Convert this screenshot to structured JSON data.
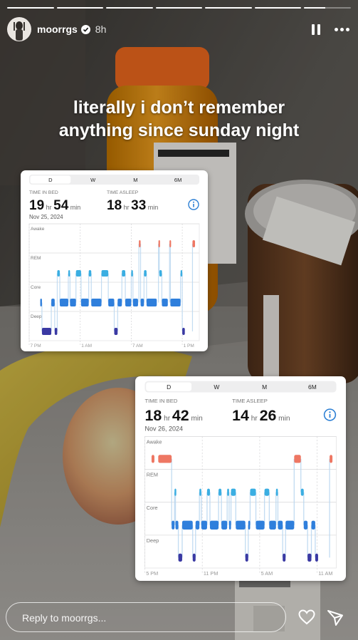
{
  "story": {
    "progress_segments": 7,
    "active_segment": 6,
    "username": "moorrgs",
    "time_ago": "8h",
    "caption_line1": "literally i don’t remember",
    "caption_line2": "anything since sunday night"
  },
  "sleep_cards": [
    {
      "tabs": [
        "D",
        "W",
        "M",
        "6M"
      ],
      "selected_tab": "D",
      "time_in_bed_label": "TIME IN BED",
      "time_in_bed_hr": "19",
      "time_in_bed_min": "54",
      "time_asleep_label": "TIME ASLEEP",
      "time_asleep_hr": "18",
      "time_asleep_min": "33",
      "hr_unit": "hr",
      "min_unit": "min",
      "date": "Nov 25, 2024",
      "stages": [
        "Awake",
        "REM",
        "Core",
        "Deep"
      ],
      "time_labels": [
        "7 PM",
        "1 AM",
        "7 AM",
        "1 PM"
      ],
      "chart_data": {
        "type": "timeline",
        "rows": [
          "Awake",
          "REM",
          "Core",
          "Deep"
        ],
        "start_time": "7 PM",
        "time_ticks": [
          "7 PM",
          "1 AM",
          "7 AM",
          "1 PM"
        ],
        "hours_span": 20,
        "segments": [
          {
            "stage": "Core",
            "start": 1.3,
            "end": 1.5
          },
          {
            "stage": "Deep",
            "start": 1.5,
            "end": 2.6
          },
          {
            "stage": "Core",
            "start": 2.6,
            "end": 3.0
          },
          {
            "stage": "Deep",
            "start": 3.0,
            "end": 3.3
          },
          {
            "stage": "REM",
            "start": 3.3,
            "end": 3.6
          },
          {
            "stage": "Core",
            "start": 3.6,
            "end": 4.6
          },
          {
            "stage": "REM",
            "start": 4.6,
            "end": 4.8
          },
          {
            "stage": "Core",
            "start": 4.8,
            "end": 5.5
          },
          {
            "stage": "REM",
            "start": 5.5,
            "end": 6.1
          },
          {
            "stage": "Core",
            "start": 6.1,
            "end": 7.0
          },
          {
            "stage": "REM",
            "start": 7.0,
            "end": 7.3
          },
          {
            "stage": "Core",
            "start": 7.3,
            "end": 8.5
          },
          {
            "stage": "REM",
            "start": 8.5,
            "end": 9.3
          },
          {
            "stage": "Core",
            "start": 9.3,
            "end": 10.0
          },
          {
            "stage": "Deep",
            "start": 10.0,
            "end": 10.4
          },
          {
            "stage": "Core",
            "start": 10.4,
            "end": 10.9
          },
          {
            "stage": "REM",
            "start": 10.9,
            "end": 11.3
          },
          {
            "stage": "Core",
            "start": 11.3,
            "end": 12.0
          },
          {
            "stage": "REM",
            "start": 12.0,
            "end": 12.2
          },
          {
            "stage": "Core",
            "start": 12.2,
            "end": 12.8
          },
          {
            "stage": "Awake",
            "start": 12.9,
            "end": 13.1
          },
          {
            "stage": "Core",
            "start": 13.1,
            "end": 13.5
          },
          {
            "stage": "REM",
            "start": 13.5,
            "end": 13.8
          },
          {
            "stage": "Core",
            "start": 13.8,
            "end": 15.0
          },
          {
            "stage": "Awake",
            "start": 15.2,
            "end": 15.3
          },
          {
            "stage": "REM",
            "start": 15.3,
            "end": 15.6
          },
          {
            "stage": "Core",
            "start": 15.6,
            "end": 16.3
          },
          {
            "stage": "Awake",
            "start": 16.5,
            "end": 16.6
          },
          {
            "stage": "Core",
            "start": 16.6,
            "end": 17.8
          },
          {
            "stage": "REM",
            "start": 17.8,
            "end": 18.0
          },
          {
            "stage": "Deep",
            "start": 18.0,
            "end": 18.3
          },
          {
            "stage": "Awake",
            "start": 19.2,
            "end": 19.5
          }
        ]
      }
    },
    {
      "tabs": [
        "D",
        "W",
        "M",
        "6M"
      ],
      "selected_tab": "D",
      "time_in_bed_label": "TIME IN BED",
      "time_in_bed_hr": "18",
      "time_in_bed_min": "42",
      "time_asleep_label": "TIME ASLEEP",
      "time_asleep_hr": "14",
      "time_asleep_min": "26",
      "hr_unit": "hr",
      "min_unit": "min",
      "date": "Nov 26, 2024",
      "stages": [
        "Awake",
        "REM",
        "Core",
        "Deep"
      ],
      "time_labels": [
        "5 PM",
        "11 PM",
        "5 AM",
        "11 AM"
      ],
      "chart_data": {
        "type": "timeline",
        "rows": [
          "Awake",
          "REM",
          "Core",
          "Deep"
        ],
        "start_time": "5 PM",
        "time_ticks": [
          "5 PM",
          "11 PM",
          "5 AM",
          "11 AM"
        ],
        "hours_span": 20,
        "segments": [
          {
            "stage": "Awake",
            "start": 0.7,
            "end": 1.0
          },
          {
            "stage": "Awake",
            "start": 1.4,
            "end": 2.8
          },
          {
            "stage": "Core",
            "start": 2.8,
            "end": 3.1
          },
          {
            "stage": "REM",
            "start": 3.1,
            "end": 3.2
          },
          {
            "stage": "Core",
            "start": 3.2,
            "end": 3.5
          },
          {
            "stage": "Deep",
            "start": 3.5,
            "end": 3.9
          },
          {
            "stage": "Core",
            "start": 3.9,
            "end": 5.0
          },
          {
            "stage": "Deep",
            "start": 5.0,
            "end": 5.3
          },
          {
            "stage": "Core",
            "start": 5.3,
            "end": 5.7
          },
          {
            "stage": "REM",
            "start": 5.7,
            "end": 5.9
          },
          {
            "stage": "Core",
            "start": 5.9,
            "end": 6.5
          },
          {
            "stage": "REM",
            "start": 6.5,
            "end": 6.8
          },
          {
            "stage": "Core",
            "start": 6.8,
            "end": 7.7
          },
          {
            "stage": "REM",
            "start": 7.7,
            "end": 8.0
          },
          {
            "stage": "Core",
            "start": 8.0,
            "end": 8.6
          },
          {
            "stage": "REM",
            "start": 8.6,
            "end": 8.8
          },
          {
            "stage": "Core",
            "start": 8.8,
            "end": 9.0
          },
          {
            "stage": "REM",
            "start": 9.0,
            "end": 9.5
          },
          {
            "stage": "Core",
            "start": 9.5,
            "end": 10.5
          },
          {
            "stage": "Deep",
            "start": 10.5,
            "end": 10.8
          },
          {
            "stage": "Core",
            "start": 10.8,
            "end": 11.0
          },
          {
            "stage": "REM",
            "start": 11.0,
            "end": 11.6
          },
          {
            "stage": "Core",
            "start": 11.6,
            "end": 12.5
          },
          {
            "stage": "REM",
            "start": 12.5,
            "end": 13.0
          },
          {
            "stage": "Core",
            "start": 13.0,
            "end": 13.7
          },
          {
            "stage": "REM",
            "start": 13.7,
            "end": 13.9
          },
          {
            "stage": "Core",
            "start": 13.9,
            "end": 14.4
          },
          {
            "stage": "Deep",
            "start": 14.4,
            "end": 14.7
          },
          {
            "stage": "Core",
            "start": 14.7,
            "end": 15.6
          },
          {
            "stage": "Awake",
            "start": 15.6,
            "end": 16.3
          },
          {
            "stage": "REM",
            "start": 16.3,
            "end": 16.6
          },
          {
            "stage": "Core",
            "start": 16.6,
            "end": 17.0
          },
          {
            "stage": "Deep",
            "start": 17.0,
            "end": 17.4
          },
          {
            "stage": "Core",
            "start": 17.4,
            "end": 17.8
          },
          {
            "stage": "Deep",
            "start": 17.8,
            "end": 18.1
          },
          {
            "stage": "Awake",
            "start": 19.3,
            "end": 19.6
          }
        ]
      }
    }
  ],
  "footer": {
    "reply_placeholder": "Reply to moorrgs..."
  },
  "icons": {
    "verified": "verified-badge-icon",
    "pause": "pause-icon",
    "more": "more-icon",
    "heart": "heart-icon",
    "send": "send-icon",
    "info": "info-icon"
  },
  "colors": {
    "awake": "#ee7763",
    "rem": "#3aaee2",
    "core": "#2f7fdc",
    "deep": "#3a39a3",
    "tab_bg": "#eeeeef",
    "info": "#2c7fd4"
  }
}
